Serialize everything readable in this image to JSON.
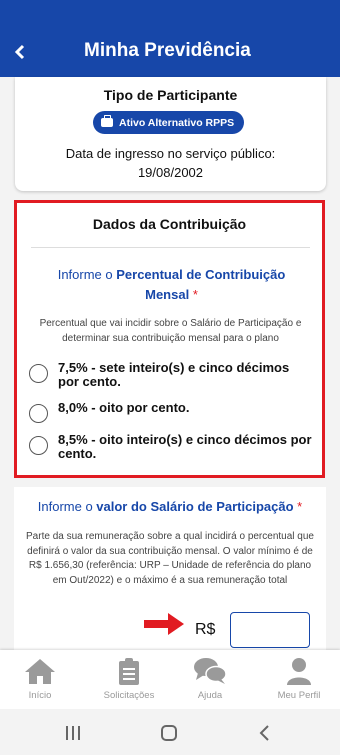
{
  "appbar": {
    "back_icon": "chevron-left-icon",
    "title": "Minha Previdência"
  },
  "participante": {
    "title": "Tipo de Participante",
    "badge_label": "Ativo Alternativo RPPS",
    "badge_icon": "briefcase-icon",
    "ingresso_label": "Data de ingresso no serviço público:",
    "ingresso_date": "19/08/2002"
  },
  "contribuicao": {
    "title": "Dados da Contribuição",
    "question_prefix": "Informe o ",
    "question_bold": "Percentual de Contribuição Mensal",
    "required_mark": "*",
    "description": "Percentual que vai incidir sobre o Salário de Participação e determinar sua contribuição mensal para o plano",
    "options": [
      {
        "label": "7,5% - sete inteiro(s) e cinco décimos por cento."
      },
      {
        "label": "8,0% - oito por cento."
      },
      {
        "label": "8,5% - oito inteiro(s) e cinco décimos por cento."
      }
    ]
  },
  "salario": {
    "question_prefix": "Informe o ",
    "question_bold": "valor do Salário de Participação",
    "required_mark": "*",
    "description": "Parte da sua remuneração sobre a qual incidirá o percentual que definirá o valor da sua contribuição mensal. O valor mínimo é de R$ 1.656,30 (referência: URP – Unidade de referência do plano em Out/2022) e o máximo é a sua remuneração total",
    "currency_label": "R$",
    "input_value": "",
    "input_placeholder": ""
  },
  "bottom_nav": [
    {
      "label": "Início",
      "icon": "home-icon"
    },
    {
      "label": "Solicitações",
      "icon": "clipboard-icon"
    },
    {
      "label": "Ajuda",
      "icon": "chat-bubbles-icon"
    },
    {
      "label": "Meu Perfil",
      "icon": "user-icon"
    }
  ],
  "colors": {
    "primary": "#1747a9",
    "highlight": "#e11b22",
    "nav_inactive": "#9a9a9a"
  }
}
